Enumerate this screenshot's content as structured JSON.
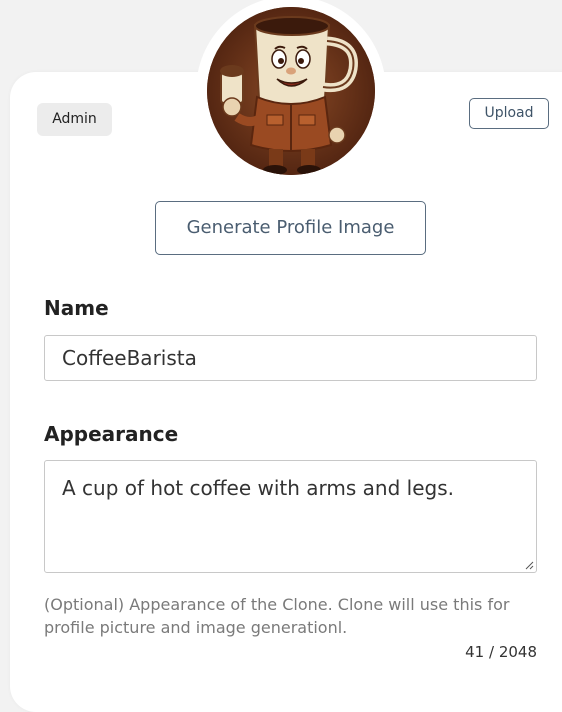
{
  "role_badge": "Admin",
  "upload_button": "Upload",
  "generate_button": "Generate Profile Image",
  "name_field": {
    "label": "Name",
    "value": "CoffeeBarista"
  },
  "appearance_field": {
    "label": "Appearance",
    "value": "A cup of hot coffee with arms and legs.",
    "help_text": "(Optional) Appearance of the Clone. Clone will use this for profile picture and image generationl.",
    "char_count": "41 / 2048"
  },
  "colors": {
    "page_background": "#f2f2f2",
    "card_background": "#ffffff",
    "button_border": "#5a6d80",
    "badge_background": "#ececec"
  }
}
